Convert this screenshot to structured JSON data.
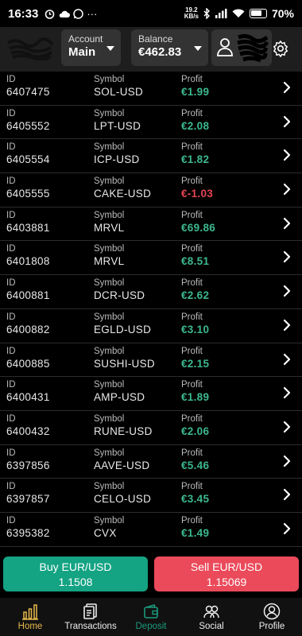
{
  "status": {
    "time": "16:33",
    "speed_top": "19.2",
    "speed_bottom": "KB/s",
    "battery": "70%"
  },
  "header": {
    "account_label": "Account",
    "account_value": "Main",
    "balance_label": "Balance",
    "balance_value": "€462.83"
  },
  "columns": {
    "id": "ID",
    "symbol": "Symbol",
    "profit": "Profit"
  },
  "trades": [
    {
      "id": "6407475",
      "symbol": "SOL-USD",
      "profit": "€1.99",
      "neg": false
    },
    {
      "id": "6405552",
      "symbol": "LPT-USD",
      "profit": "€2.08",
      "neg": false
    },
    {
      "id": "6405554",
      "symbol": "ICP-USD",
      "profit": "€1.82",
      "neg": false
    },
    {
      "id": "6405555",
      "symbol": "CAKE-USD",
      "profit": "€-1.03",
      "neg": true
    },
    {
      "id": "6403881",
      "symbol": "MRVL",
      "profit": "€69.86",
      "neg": false
    },
    {
      "id": "6401808",
      "symbol": "MRVL",
      "profit": "€8.51",
      "neg": false
    },
    {
      "id": "6400881",
      "symbol": "DCR-USD",
      "profit": "€2.62",
      "neg": false
    },
    {
      "id": "6400882",
      "symbol": "EGLD-USD",
      "profit": "€3.10",
      "neg": false
    },
    {
      "id": "6400885",
      "symbol": "SUSHI-USD",
      "profit": "€2.15",
      "neg": false
    },
    {
      "id": "6400431",
      "symbol": "AMP-USD",
      "profit": "€1.89",
      "neg": false
    },
    {
      "id": "6400432",
      "symbol": "RUNE-USD",
      "profit": "€2.06",
      "neg": false
    },
    {
      "id": "6397856",
      "symbol": "AAVE-USD",
      "profit": "€5.46",
      "neg": false
    },
    {
      "id": "6397857",
      "symbol": "CELO-USD",
      "profit": "€3.45",
      "neg": false
    },
    {
      "id": "6395382",
      "symbol": "CVX",
      "profit": "€1.49",
      "neg": false
    }
  ],
  "trade_buttons": {
    "buy_label": "Buy EUR/USD",
    "buy_price": "1.1508",
    "sell_label": "Sell EUR/USD",
    "sell_price": "1.15069"
  },
  "nav": [
    {
      "label": "Home",
      "icon": "bar-chart-icon"
    },
    {
      "label": "Transactions",
      "icon": "document-icon"
    },
    {
      "label": "Deposit",
      "icon": "wallet-icon"
    },
    {
      "label": "Social",
      "icon": "people-icon"
    },
    {
      "label": "Profile",
      "icon": "person-icon"
    }
  ],
  "colors": {
    "positive": "#3cb88e",
    "negative": "#e54552",
    "buy": "#14a383",
    "sell": "#ea4a5a",
    "active_nav": "#e6b84a"
  }
}
